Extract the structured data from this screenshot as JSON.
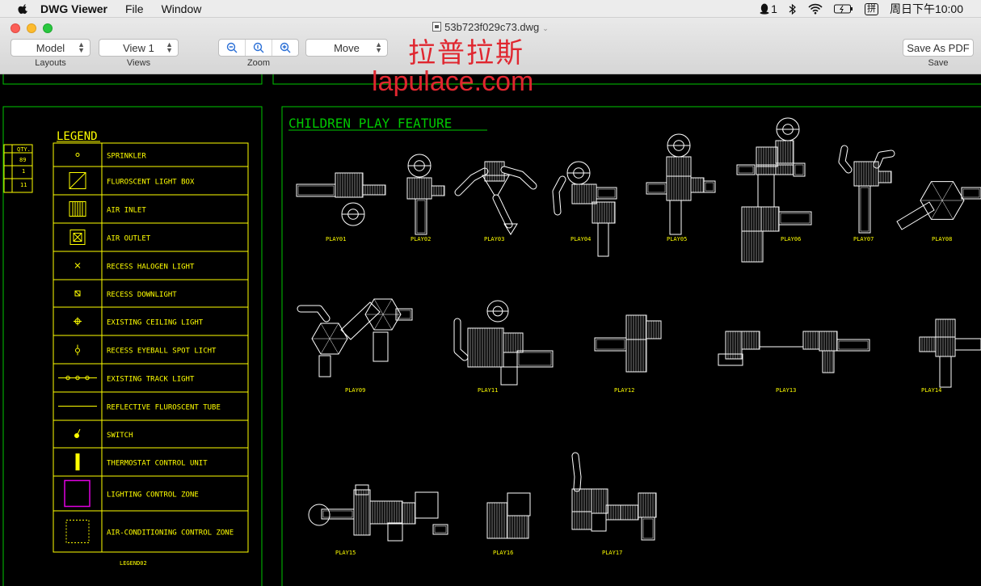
{
  "menubar": {
    "app_name": "DWG Viewer",
    "items": [
      "File",
      "Window"
    ],
    "status_qq_count": "1",
    "status_input_method": "拼",
    "clock": "周日下午10:00"
  },
  "window": {
    "title": "53b723f029c73.dwg"
  },
  "toolbar": {
    "layout_value": "Model",
    "layout_caption": "Layouts",
    "view_value": "View 1",
    "view_caption": "Views",
    "zoom_caption": "Zoom",
    "tool_value": "Move",
    "save_label": "Save As PDF",
    "save_caption": "Save"
  },
  "watermark": {
    "cn": "拉普拉斯",
    "url": "lapulace.com"
  },
  "drawing": {
    "colors": {
      "frame": "#00c800",
      "legend": "#ffff00",
      "lines": "#ffffff",
      "zone": "#e000e0"
    },
    "qty_header": "QTY.",
    "qty_values": [
      "89",
      "1",
      "11"
    ],
    "legend_title": "LEGEND",
    "legend_items": [
      {
        "icon": "sprinkler-icon",
        "label": "SPRINKLER"
      },
      {
        "icon": "fluorescent-light-box-icon",
        "label": "FLUROSCENT LIGHT BOX"
      },
      {
        "icon": "air-inlet-icon",
        "label": "AIR INLET"
      },
      {
        "icon": "air-outlet-icon",
        "label": "AIR OUTLET"
      },
      {
        "icon": "recess-halogen-light-icon",
        "label": "RECESS HALOGEN LIGHT"
      },
      {
        "icon": "recess-downlight-icon",
        "label": "RECESS DOWNLIGHT"
      },
      {
        "icon": "existing-ceiling-light-icon",
        "label": "EXISTING CEILING LIGHT"
      },
      {
        "icon": "recess-eyeball-spot-light-icon",
        "label": "RECESS EYEBALL SPOT LICHT"
      },
      {
        "icon": "existing-track-light-icon",
        "label": "EXISTING TRACK LIGHT"
      },
      {
        "icon": "reflective-fluorescent-tube-icon",
        "label": "REFLECTIVE FLUROSCENT TUBE"
      },
      {
        "icon": "switch-icon",
        "label": "SWITCH"
      },
      {
        "icon": "thermostat-control-unit-icon",
        "label": "THERMOSTAT CONTROL UNIT"
      },
      {
        "icon": "lighting-control-zone-icon",
        "label": "LIGHTING CONTROL ZONE"
      },
      {
        "icon": "air-conditioning-control-zone-icon",
        "label": "AIR-CONDITIONING CONTROL ZONE"
      }
    ],
    "legend_id": "LEGEND02",
    "feature_title": "CHILDREN PLAY FEATURE",
    "play_labels": [
      "PLAY01",
      "PLAY02",
      "PLAY03",
      "PLAY04",
      "PLAY05",
      "PLAY06",
      "PLAY07",
      "PLAY08",
      "PLAY09",
      "PLAY11",
      "PLAY12",
      "PLAY13",
      "PLAY14",
      "PLAY15",
      "PLAY16",
      "PLAY17"
    ]
  }
}
